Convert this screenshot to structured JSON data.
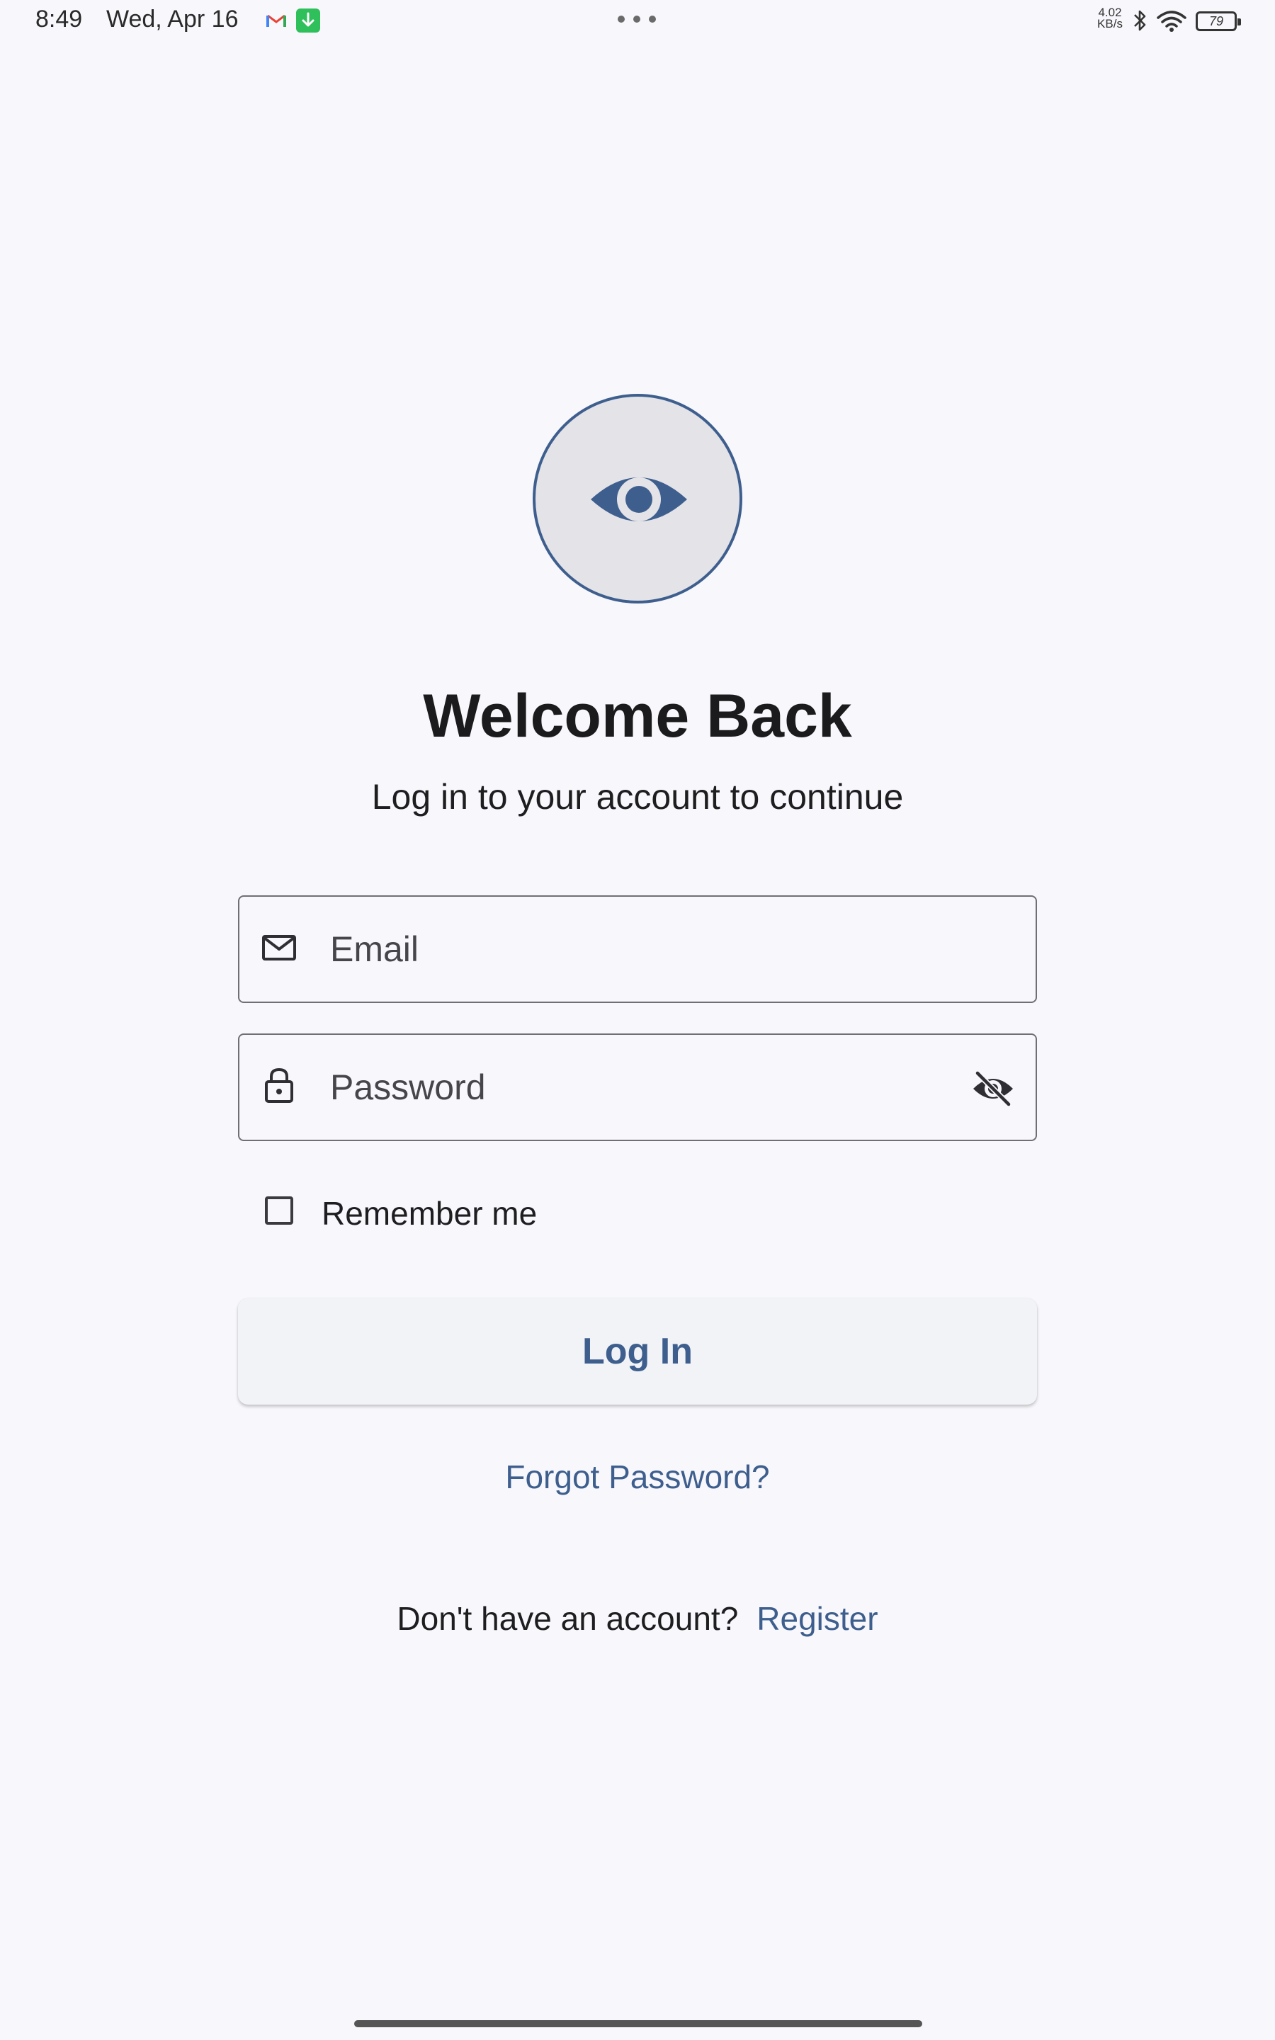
{
  "status_bar": {
    "time": "8:49",
    "date": "Wed, Apr 16",
    "net_speed_value": "4.02",
    "net_speed_unit": "KB/s",
    "battery_level": "79",
    "icons": [
      "gmail-icon",
      "download-icon",
      "more-dots-icon",
      "bluetooth-icon",
      "wifi-icon",
      "battery-icon"
    ]
  },
  "logo": {
    "icon": "eye-icon"
  },
  "header": {
    "title": "Welcome Back",
    "subtitle": "Log in to your account to continue"
  },
  "form": {
    "email": {
      "placeholder": "Email",
      "value": "",
      "icon": "mail-icon"
    },
    "password": {
      "placeholder": "Password",
      "value": "",
      "icon": "lock-icon",
      "toggle_icon": "visibility-off-icon"
    },
    "remember": {
      "label": "Remember me",
      "checked": false
    },
    "login_label": "Log In",
    "forgot_label": "Forgot Password?"
  },
  "footer": {
    "prompt": "Don't have an account?",
    "register_label": "Register"
  },
  "colors": {
    "accent": "#3e5f8e",
    "background": "#f8f8fc",
    "text": "#1c1c1f",
    "logo_bg": "#e3e3e8"
  }
}
